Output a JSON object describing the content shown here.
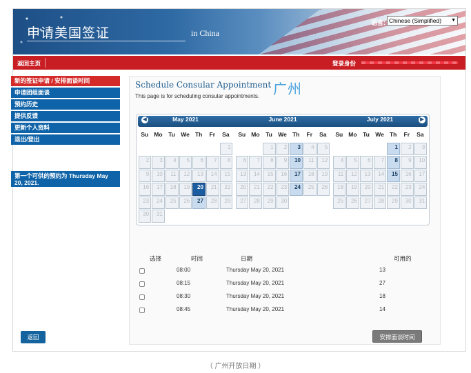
{
  "header": {
    "title": "申请美国签证",
    "subtitle": "in China",
    "language_label": "语言:",
    "language_value": "Chinese (Simplified)"
  },
  "redbar": {
    "home": "返回主页",
    "login_label": "登录身份"
  },
  "sidebar": {
    "items": [
      {
        "label": "新的签证申请 / 安排面谈时间",
        "active": true
      },
      {
        "label": "申请团组面谈"
      },
      {
        "label": "预约历史"
      },
      {
        "label": "提供反馈"
      },
      {
        "label": "更新个人资料"
      },
      {
        "label": "退出/登出"
      }
    ],
    "first_available": "第一个可供的预约为 Thursday May 20, 2021."
  },
  "main": {
    "heading": "Schedule Consular Appointment",
    "description": "This page is for scheduling consular appointments.",
    "city": "广州"
  },
  "calendar": {
    "weekdays": [
      "Su",
      "Mo",
      "Tu",
      "We",
      "Th",
      "Fr",
      "Sa"
    ],
    "months": [
      {
        "title": "May 2021",
        "first_weekday": 6,
        "days": 31,
        "available": [
          20,
          27
        ],
        "selected": 20
      },
      {
        "title": "June 2021",
        "first_weekday": 2,
        "days": 30,
        "available": [
          3,
          10,
          17,
          24
        ],
        "selected": null
      },
      {
        "title": "July 2021",
        "first_weekday": 4,
        "days": 31,
        "available": [
          1,
          8,
          15
        ],
        "selected": null
      }
    ]
  },
  "slots": {
    "headers": {
      "select": "选择",
      "time": "时间",
      "date": "日期",
      "available": "可用的"
    },
    "rows": [
      {
        "time": "08:00",
        "date": "Thursday May 20, 2021",
        "count": "13"
      },
      {
        "time": "08:15",
        "date": "Thursday May 20, 2021",
        "count": "27"
      },
      {
        "time": "08:30",
        "date": "Thursday May 20, 2021",
        "count": "18"
      },
      {
        "time": "08:45",
        "date": "Thursday May 20, 2021",
        "count": "14"
      }
    ]
  },
  "buttons": {
    "back": "返回",
    "schedule": "安排面谈时间"
  },
  "caption": "（ 广州开放日期 ）"
}
